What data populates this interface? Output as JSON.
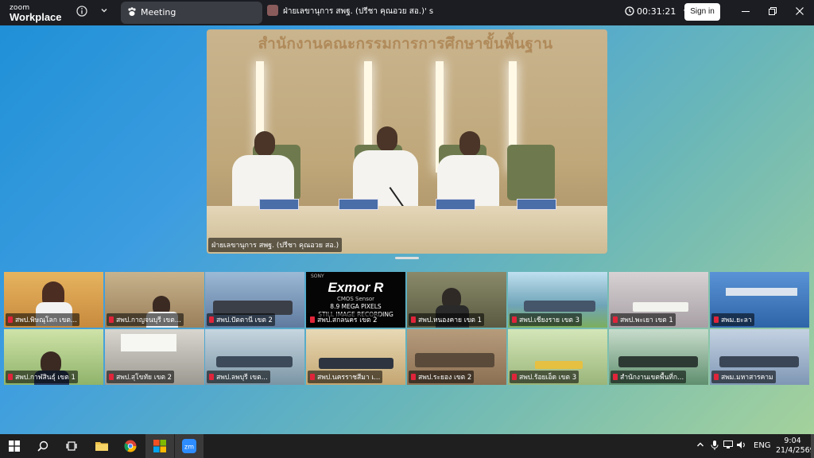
{
  "app": {
    "logo_small": "zoom",
    "logo_large": "Workplace"
  },
  "titlebar": {
    "meeting_tab": "Meeting",
    "share_label": "ฝ่ายเลขานุการ สพฐ. (ปรีชา  คุณอวย สอ.)' s",
    "timer": "00:31:21",
    "signin": "Sign in"
  },
  "main_video": {
    "sign_text": "สำนักงานคณะกรรมการการศึกษาขั้นพื้นฐาน",
    "participant": "ฝ่ายเลขานุการ สพฐ. (ปรีชา  คุณอวย สอ.)"
  },
  "exmor": {
    "brand": "SONY",
    "title": "Exmor R",
    "sub": "CMOS Sensor",
    "line1": "8.9 MEGA PIXELS",
    "line2": "STILL IMAGE RECORDING"
  },
  "gallery": [
    {
      "name": "สพป.พิษณุโลก เขต...",
      "tone": "#c88a3e"
    },
    {
      "name": "สพป.กาญจนบุรี เขต...",
      "tone": "#9a7f5a"
    },
    {
      "name": "สพป.ปัตตานี เขต 2",
      "tone": "#5f7a9e"
    },
    {
      "name": "สพป.สกลนคร เขต 2",
      "tone": "#000000"
    },
    {
      "name": "สพป.หนองคาย เขต 1",
      "tone": "#6f6f52"
    },
    {
      "name": "สพป.เชียงราย เขต 3",
      "tone": "#6fa4b8"
    },
    {
      "name": "สพป.พะเยา เขต 1",
      "tone": "#b9b3b8"
    },
    {
      "name": "สพม.ยะลา",
      "tone": "#3d76b8"
    },
    {
      "name": "สพป.กาฬสินธุ์ เขต 1",
      "tone": "#8fb36a"
    },
    {
      "name": "สพป.สุโขทัย เขต 2",
      "tone": "#b0ada4"
    },
    {
      "name": "สพป.ลพบุรี เขต...",
      "tone": "#7b95a5"
    },
    {
      "name": "สพป.นครราชสีมา เ...",
      "tone": "#c4a671"
    },
    {
      "name": "สพป.ระยอง เขต 2",
      "tone": "#8b6f52"
    },
    {
      "name": "สพป.ร้อยเอ็ด เขต 3",
      "tone": "#9ab57a"
    },
    {
      "name": "สำนักงานเขตพื้นที่ก...",
      "tone": "#5f8f6e"
    },
    {
      "name": "สพม.มหาสารคาม",
      "tone": "#7f97b5"
    }
  ],
  "taskbar": {
    "lang": "ENG",
    "time": "9:04",
    "date": "21/4/2569"
  },
  "icons": {
    "info": "info-icon",
    "chevron": "chevron-down-icon",
    "clock": "clock-icon",
    "minimize": "minimize-icon",
    "restore": "restore-icon",
    "close": "close-icon"
  }
}
